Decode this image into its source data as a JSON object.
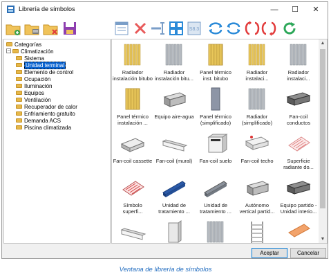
{
  "window": {
    "title": "Librería de símbolos"
  },
  "title_controls": {
    "minimize": "—",
    "maximize": "☐",
    "close": "✕"
  },
  "toolbar_icons": [
    "new-folder-icon",
    "folder-edit-icon",
    "delete-folder-icon",
    "save-icon",
    "form-icon",
    "delete-icon",
    "insert-icon",
    "grid-view-icon",
    "metadata-icon",
    "import-icon",
    "export-icon",
    "rotate-icon",
    "flip-icon",
    "refresh-icon"
  ],
  "tree": {
    "root": "Categorías",
    "group": "Climatización",
    "children": [
      "Sistema",
      "Unidad terminal",
      "Elemento de control",
      "Ocupación",
      "Iluminación",
      "Equipos",
      "Ventilación",
      "Recuperador de calor",
      "Enfriamiento gratuito",
      "Demanda ACS",
      "Piscina climatizada"
    ],
    "selected_index": 1
  },
  "symbols": [
    {
      "line1": "Radiador",
      "line2": "instalación bitubo",
      "kind": "radiator-yellow"
    },
    {
      "line1": "Radiador",
      "line2": "instalación bitu...",
      "kind": "radiator-gray"
    },
    {
      "line1": "Panel térmico",
      "line2": "inst. bitubo",
      "kind": "panel-yellow"
    },
    {
      "line1": "Radiador",
      "line2": "instalaci...",
      "kind": "radiator-yellow"
    },
    {
      "line1": "Radiador",
      "line2": "instalaci...",
      "kind": "radiator-gray"
    },
    {
      "line1": "Panel térmico",
      "line2": "instalación ...",
      "kind": "panel-yellow"
    },
    {
      "line1": "Equipo aire-agua",
      "line2": "",
      "kind": "box-gray"
    },
    {
      "line1": "Panel térmico",
      "line2": "(simplificado)",
      "kind": "panel-thin"
    },
    {
      "line1": "Radiador",
      "line2": "(simplificado)",
      "kind": "radiator-gray"
    },
    {
      "line1": "Fan-coil",
      "line2": "conductos",
      "kind": "box-dark"
    },
    {
      "line1": "Fan-coil cassette",
      "line2": "",
      "kind": "cassette"
    },
    {
      "line1": "Fan-coil (mural)",
      "line2": "",
      "kind": "mural"
    },
    {
      "line1": "Fan-coil suelo",
      "line2": "",
      "kind": "floor-unit"
    },
    {
      "line1": "Fan-coil techo",
      "line2": "",
      "kind": "ceiling-unit"
    },
    {
      "line1": "Superficie",
      "line2": "radiante do...",
      "kind": "radiant"
    },
    {
      "line1": "Símbolo",
      "line2": "superfi...",
      "kind": "radiant-red"
    },
    {
      "line1": "Unidad de",
      "line2": "tratamiento ...",
      "kind": "duct-blue"
    },
    {
      "line1": "Unidad de",
      "line2": "tratamiento ...",
      "kind": "duct-gray"
    },
    {
      "line1": "Autónomo",
      "line2": "vertical partid...",
      "kind": "box-gray"
    },
    {
      "line1": "Equipo partido -",
      "line2": "Unidad interio...",
      "kind": "box-dark"
    },
    {
      "line1": "",
      "line2": "",
      "kind": "mural"
    },
    {
      "line1": "",
      "line2": "",
      "kind": "tower"
    },
    {
      "line1": "",
      "line2": "",
      "kind": "radiator-gray"
    },
    {
      "line1": "",
      "line2": "",
      "kind": "towel"
    },
    {
      "line1": "",
      "line2": "",
      "kind": "orange"
    }
  ],
  "buttons": {
    "accept": "Aceptar",
    "cancel": "Cancelar"
  },
  "caption": "Ventana de librería de símbolos",
  "colors": {
    "selection": "#0a64d2",
    "toolbar_blue": "#2a8ad8",
    "toolbar_red": "#e23b3b",
    "folder": "#e6b84a",
    "caption": "#1f6bbf"
  }
}
